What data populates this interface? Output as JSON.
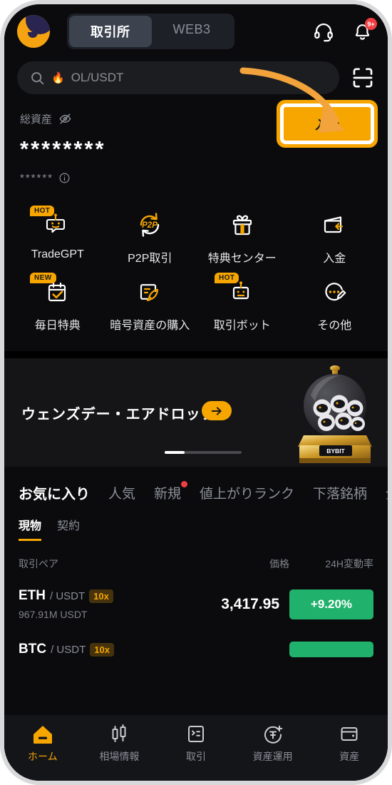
{
  "header": {
    "avatar_name": "user-avatar",
    "segments": [
      {
        "label": "取引所",
        "active": true
      },
      {
        "label": "WEB3",
        "active": false
      }
    ],
    "support_icon": "headset-icon",
    "bell_icon": "bell-icon",
    "bell_badge": "9+"
  },
  "search": {
    "flame": "🔥",
    "query": "OL/USDT",
    "scan_icon": "scan-icon"
  },
  "assets": {
    "label": "総資産",
    "eye_icon": "eye-off-icon",
    "masked_value": "********",
    "masked_sub": "******",
    "info_icon": "info-icon",
    "deposit_label": "入金",
    "highlight_color": "#f7a600"
  },
  "quick_actions": [
    {
      "label": "TradeGPT",
      "icon": "robot-chat-icon",
      "tag": "HOT"
    },
    {
      "label": "P2P取引",
      "icon": "p2p-icon",
      "tag": ""
    },
    {
      "label": "特典センター",
      "icon": "gift-icon",
      "tag": ""
    },
    {
      "label": "入金",
      "icon": "card-deposit-icon",
      "tag": ""
    },
    {
      "label": "毎日特典",
      "icon": "calendar-check-icon",
      "tag": "NEW"
    },
    {
      "label": "暗号資産の購入",
      "icon": "rocket-card-icon",
      "tag": ""
    },
    {
      "label": "取引ボット",
      "icon": "robot-icon",
      "tag": "HOT"
    },
    {
      "label": "その他",
      "icon": "more-edit-icon",
      "tag": ""
    }
  ],
  "banner": {
    "title": "ウェンズデー・エアドロップ",
    "cta_icon": "arrow-right-icon",
    "brand": "BYBIT",
    "image_name": "gold-gumball-machine"
  },
  "market": {
    "categories": [
      {
        "label": "お気に入り",
        "active": true,
        "dot": false
      },
      {
        "label": "人気",
        "active": false,
        "dot": false
      },
      {
        "label": "新規",
        "active": false,
        "dot": true
      },
      {
        "label": "値上がりランク",
        "active": false,
        "dot": false
      },
      {
        "label": "下落銘柄",
        "active": false,
        "dot": false
      },
      {
        "label": "全",
        "active": false,
        "dot": false
      }
    ],
    "subtabs": [
      {
        "label": "現物",
        "active": true
      },
      {
        "label": "契約",
        "active": false
      }
    ],
    "columns": [
      "取引ペア",
      "価格",
      "24H変動率"
    ],
    "rows": [
      {
        "base": "ETH",
        "quote": "/ USDT",
        "leverage": "10x",
        "volume": "967.91M USDT",
        "price": "3,417.95",
        "change": "+9.20%",
        "change_color": "#20b26c"
      },
      {
        "base": "BTC",
        "quote": "/ USDT",
        "leverage": "10x",
        "volume": "",
        "price": "",
        "change": "",
        "change_color": "#20b26c"
      }
    ]
  },
  "bottom_nav": [
    {
      "label": "ホーム",
      "icon": "home-icon",
      "active": true
    },
    {
      "label": "相場情報",
      "icon": "candlestick-icon",
      "active": false
    },
    {
      "label": "取引",
      "icon": "trade-list-icon",
      "active": false
    },
    {
      "label": "資産運用",
      "icon": "earn-icon",
      "active": false
    },
    {
      "label": "資産",
      "icon": "wallet-icon",
      "active": false
    }
  ]
}
